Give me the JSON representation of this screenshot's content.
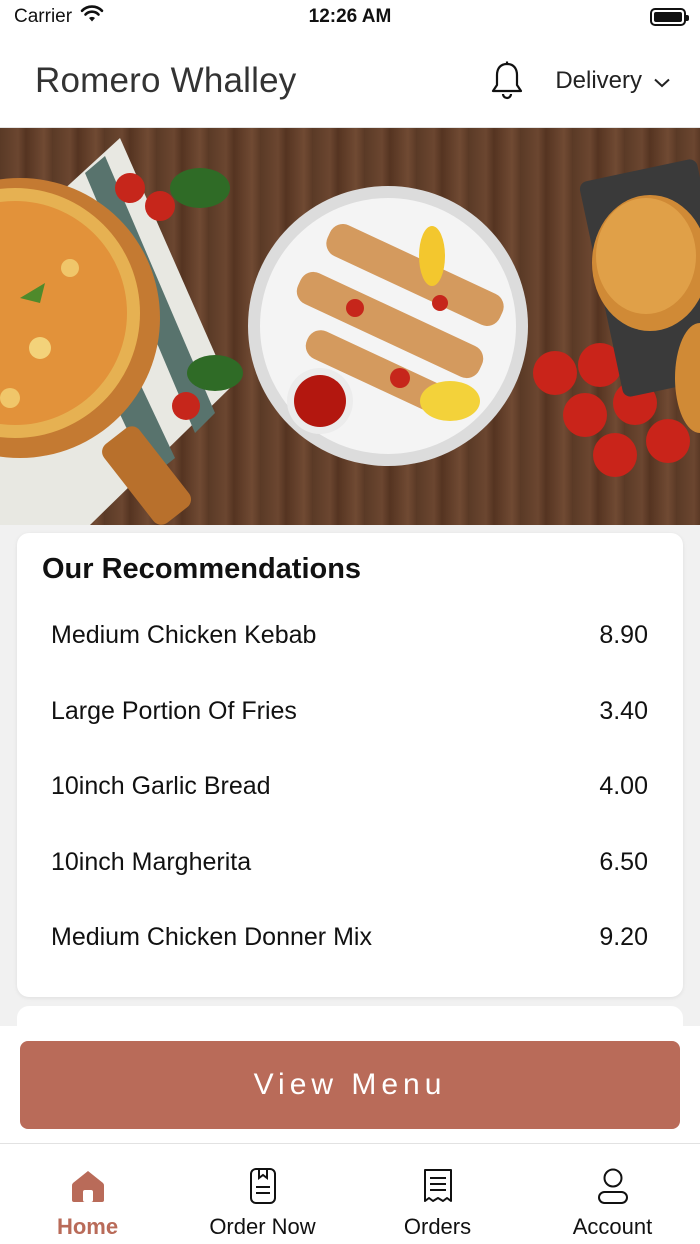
{
  "status_bar": {
    "carrier": "Carrier",
    "time": "12:26 AM"
  },
  "header": {
    "store_name": "Romero Whalley",
    "order_mode": "Delivery"
  },
  "recommendations": {
    "title": "Our Recommendations",
    "items": [
      {
        "name": "Medium Chicken Kebab",
        "price": "8.90"
      },
      {
        "name": "Large Portion Of Fries",
        "price": "3.40"
      },
      {
        "name": "10inch Garlic Bread",
        "price": "4.00"
      },
      {
        "name": "10inch Margherita",
        "price": "6.50"
      },
      {
        "name": "Medium Chicken Donner Mix",
        "price": "9.20"
      }
    ]
  },
  "cta": {
    "view_menu_label": "View Menu"
  },
  "tabs": [
    {
      "label": "Home",
      "icon": "home-icon",
      "active": true
    },
    {
      "label": "Order Now",
      "icon": "order-now-icon",
      "active": false
    },
    {
      "label": "Orders",
      "icon": "receipt-icon",
      "active": false
    },
    {
      "label": "Account",
      "icon": "account-icon",
      "active": false
    }
  ],
  "colors": {
    "accent": "#b96b59",
    "background": "#f1f1f1"
  }
}
